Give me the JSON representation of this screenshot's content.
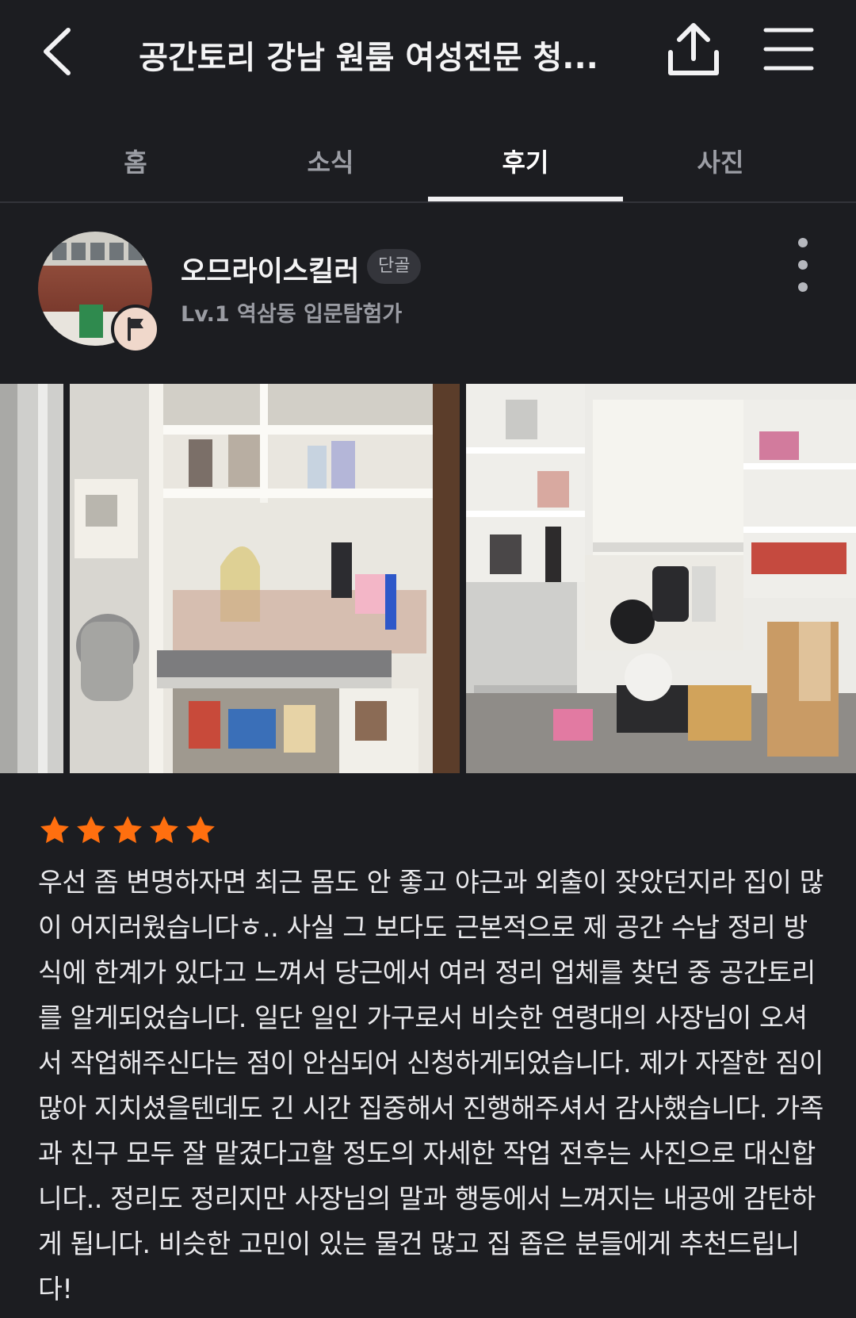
{
  "header": {
    "title": "공간토리 강남 원룸 여성전문 청...",
    "back_icon": "chevron-left-icon",
    "share_icon": "share-icon",
    "menu_icon": "hamburger-menu-icon"
  },
  "tabs": [
    {
      "label": "홈",
      "active": false
    },
    {
      "label": "소식",
      "active": false
    },
    {
      "label": "후기",
      "active": true
    },
    {
      "label": "사진",
      "active": false
    }
  ],
  "review": {
    "author": "오므라이스킬러",
    "author_badge": "단골",
    "author_level": "Lv.1 역삼동 입문탐험가",
    "rating": 5,
    "rating_max": 5,
    "text": "우선 좀 변명하자면 최근 몸도 안 좋고 야근과 외출이 잦았던지라 집이 많이 어지러웠습니다ㅎ.. 사실 그 보다도 근본적으로 제 공간 수납 정리 방식에 한계가 있다고 느껴서 당근에서 여러 정리 업체를 찾던 중 공간토리를 알게되었습니다. 일단 일인 가구로서 비슷한 연령대의 사장님이 오셔서 작업해주신다는 점이 안심되어 신청하게되었습니다. 제가 자잘한 짐이 많아 지치셨을텐데도 긴 시간 집중해서 진행해주셔서 감사했습니다. 가족과 친구 모두 잘 맡겼다고할 정도의 자세한 작업 전후는 사진으로 대신합니다.. 정리도 정리지만 사장님의 말과 행동에서 느껴지는 내공에 감탄하게 됩니다. 비슷한 고민이 있는 물건 많고 집 좁은 분들에게 추천드립니다!"
  },
  "colors": {
    "background": "#1c1d21",
    "star": "#ff6f0f",
    "active_tab": "#ffffff",
    "inactive_tab": "#9c9ea5"
  }
}
